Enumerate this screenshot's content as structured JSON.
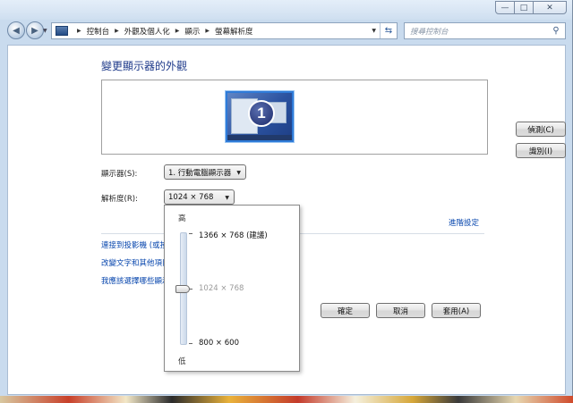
{
  "window": {
    "caption_buttons": {
      "min": "—",
      "max": "□",
      "close": "✕"
    }
  },
  "nav": {
    "breadcrumbs": [
      "控制台",
      "外觀及個人化",
      "顯示",
      "螢幕解析度"
    ],
    "search_placeholder": "搜尋控制台"
  },
  "page": {
    "title": "變更顯示器的外觀",
    "monitor_number": "1",
    "detect_label": "偵測(C)",
    "identify_label": "識別(I)",
    "display_label": "顯示器(S):",
    "display_value": "1. 行動電腦顯示器",
    "resolution_label": "解析度(R):",
    "resolution_value": "1024 × 768",
    "advanced_link": "進階設定",
    "links": [
      "連接到投影機 (或按",
      "改變文字和其他項目",
      "我應該選擇哪些顯示"
    ],
    "ok_label": "確定",
    "cancel_label": "取消",
    "apply_label": "套用(A)"
  },
  "resolution_popup": {
    "high_label": "高",
    "low_label": "低",
    "options": [
      "1366 × 768 (建議)",
      "1024 × 768",
      "800 × 600"
    ],
    "selected_index": 1
  }
}
